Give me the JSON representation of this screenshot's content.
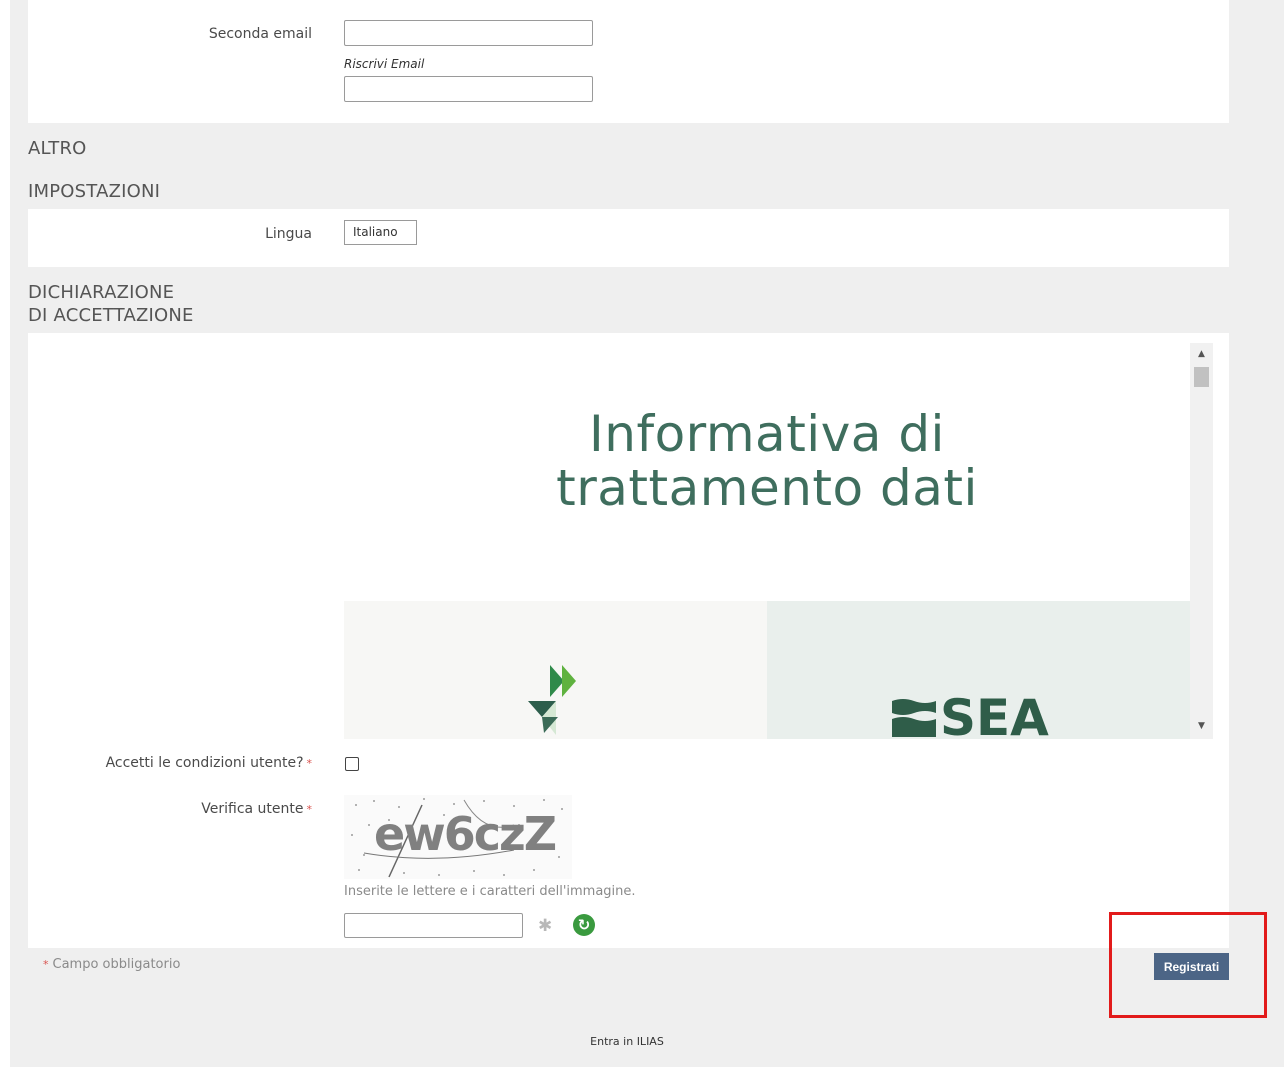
{
  "email": {
    "second_email_label": "Seconda email",
    "second_email_value": "",
    "retype_label": "Riscrivi Email",
    "retype_value": ""
  },
  "sections": {
    "other": "ALTRO",
    "settings": "IMPOSTAZIONI",
    "declaration_line1": "DICHIARAZIONE",
    "declaration_line2": "DI ACCETTAZIONE"
  },
  "settings": {
    "language_label": "Lingua",
    "language_value": "Italiano"
  },
  "terms": {
    "title_line1": "Informativa di",
    "title_line2": "trattamento dati",
    "logo_right_text": "SEA"
  },
  "accept": {
    "label": "Accetti le condizioni utente?",
    "required_mark": "*",
    "checked": false
  },
  "captcha": {
    "label": "Verifica utente",
    "required_mark": "*",
    "image_text": "ew6czZ",
    "hint": "Inserite le lettere e i caratteri dell'immagine.",
    "value": ""
  },
  "footer": {
    "required_note_mark": "*",
    "required_note": "Campo obbligatorio",
    "register_button": "Registrati",
    "login_link": "Entra in ILIAS"
  },
  "colors": {
    "accent_button": "#4c6586",
    "title_green": "#3f6e5e",
    "highlight": "#e21b1b",
    "required": "#d9534f"
  }
}
